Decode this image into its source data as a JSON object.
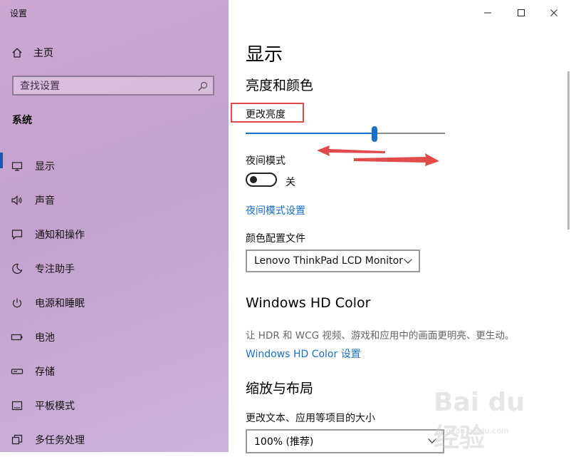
{
  "window": {
    "title": "设置"
  },
  "sidebar": {
    "home_label": "主页",
    "search_placeholder": "查找设置",
    "group_label": "系统",
    "items": [
      {
        "label": "显示",
        "icon": "monitor-icon",
        "active": true
      },
      {
        "label": "声音",
        "icon": "speaker-icon",
        "active": false
      },
      {
        "label": "通知和操作",
        "icon": "notification-icon",
        "active": false
      },
      {
        "label": "专注助手",
        "icon": "moon-icon",
        "active": false
      },
      {
        "label": "电源和睡眠",
        "icon": "power-icon",
        "active": false
      },
      {
        "label": "电池",
        "icon": "battery-icon",
        "active": false
      },
      {
        "label": "存储",
        "icon": "storage-icon",
        "active": false
      },
      {
        "label": "平板模式",
        "icon": "tablet-icon",
        "active": false
      },
      {
        "label": "多任务处理",
        "icon": "multitask-icon",
        "active": false
      }
    ]
  },
  "main": {
    "page_title": "显示",
    "section_brightness_color": "亮度和颜色",
    "brightness_label": "更改亮度",
    "brightness_value": 0.645,
    "night_mode_label": "夜间模式",
    "night_mode_state": "关",
    "night_mode_settings_link": "夜间模式设置",
    "color_profile_label": "颜色配置文件",
    "color_profile_value": "Lenovo ThinkPad LCD Monitor",
    "hd_color_heading": "Windows HD Color",
    "hd_color_desc": "让 HDR 和 WCG 视频、游戏和应用中的画面更明亮、更生动。",
    "hd_color_link": "Windows HD Color 设置",
    "scale_heading": "缩放与布局",
    "scale_label": "更改文本、应用等项目的大小",
    "scale_value": "100% (推荐)"
  },
  "watermark": {
    "main": "Bai du 经验",
    "sub": "jingyan.baidu.com"
  },
  "colors": {
    "accent": "#1a6fc9",
    "annotation": "#e24b4b",
    "sidebar_bg": "#c7a5d3"
  }
}
